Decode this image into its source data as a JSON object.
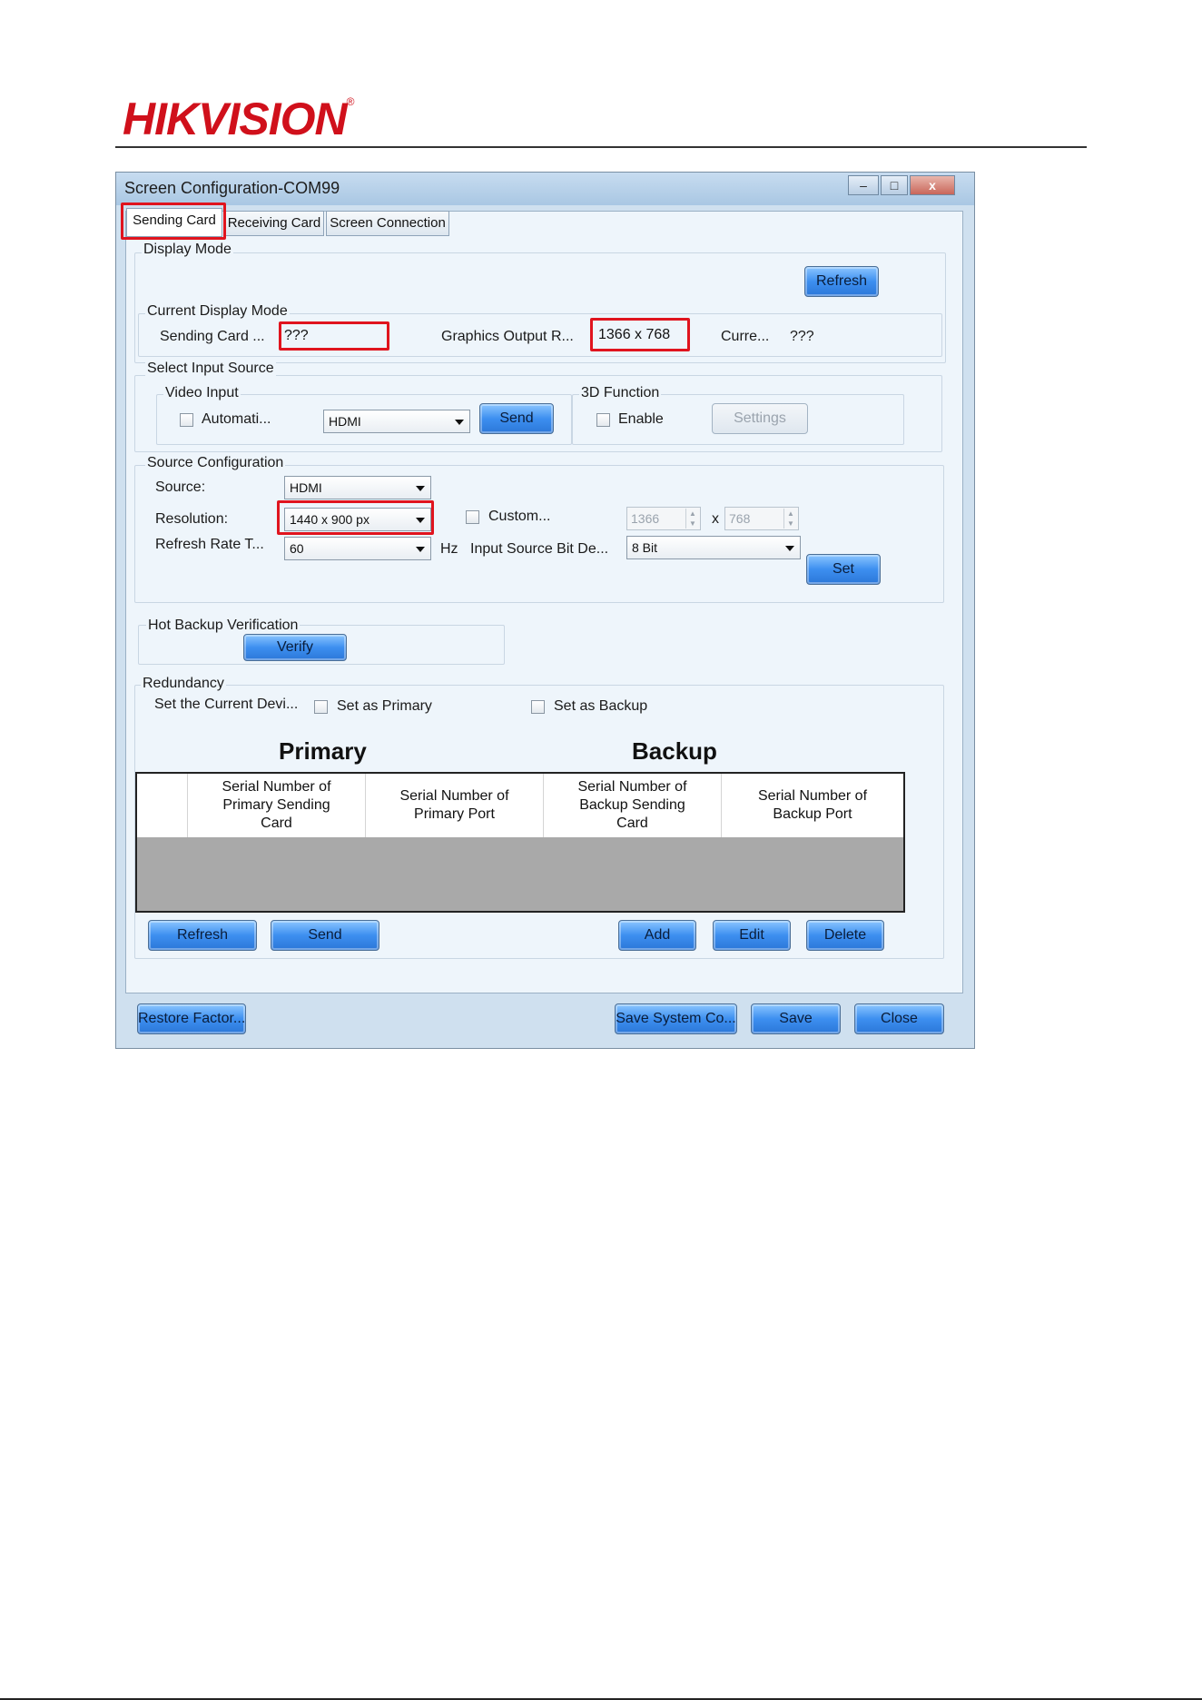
{
  "header": {
    "logo_text": "HIKVISION"
  },
  "window": {
    "title": "Screen Configuration-COM99",
    "controls": {
      "minimize": "–",
      "maximize": "□",
      "close": "x"
    }
  },
  "tabs": [
    {
      "label": "Sending Card",
      "active": true
    },
    {
      "label": "Receiving Card",
      "active": false
    },
    {
      "label": "Screen Connection",
      "active": false
    }
  ],
  "display_mode": {
    "group_label": "Display Mode",
    "refresh_label": "Refresh",
    "current": {
      "group_label": "Current Display Mode",
      "sending_card_label": "Sending Card ...",
      "sending_card_value": "???",
      "graphics_output_label": "Graphics Output R...",
      "graphics_output_value": "1366 x 768",
      "current_label": "Curre...",
      "current_value": "???"
    }
  },
  "input_source": {
    "group_label": "Select Input Source",
    "video_input": {
      "group_label": "Video Input",
      "auto_label": "Automati...",
      "source_value": "HDMI",
      "send_label": "Send"
    },
    "function_3d": {
      "group_label": "3D Function",
      "enable_label": "Enable",
      "settings_label": "Settings"
    }
  },
  "source_config": {
    "group_label": "Source Configuration",
    "source_label": "Source:",
    "source_value": "HDMI",
    "resolution_label": "Resolution:",
    "resolution_value": "1440 x 900 px",
    "custom_label": "Custom...",
    "custom_width": "1366",
    "x_label": "x",
    "custom_height": "768",
    "refresh_rate_label": "Refresh Rate T...",
    "refresh_rate_value": "60",
    "hz_label": "Hz",
    "bit_depth_label": "Input Source Bit De...",
    "bit_depth_value": "8 Bit",
    "set_label": "Set"
  },
  "hot_backup": {
    "group_label": "Hot Backup Verification",
    "verify_label": "Verify"
  },
  "redundancy": {
    "group_label": "Redundancy",
    "set_current_label": "Set the Current Devi...",
    "set_primary_label": "Set as Primary",
    "set_backup_label": "Set as Backup",
    "primary_title": "Primary",
    "backup_title": "Backup",
    "columns": [
      [
        "Serial Number of",
        "Primary Sending",
        "Card"
      ],
      [
        "Serial Number of",
        "Primary Port"
      ],
      [
        "Serial Number of",
        "Backup Sending",
        "Card"
      ],
      [
        "Serial Number of",
        "Backup Port"
      ]
    ],
    "buttons": {
      "refresh": "Refresh",
      "send": "Send",
      "add": "Add",
      "edit": "Edit",
      "delete": "Delete"
    }
  },
  "footer_buttons": {
    "restore": "Restore Factor...",
    "save_system": "Save System Co...",
    "save": "Save",
    "close": "Close"
  },
  "colors": {
    "brand_red": "#d0101b",
    "highlight_red": "#e0141e",
    "button_blue": "#3d8ff0"
  }
}
